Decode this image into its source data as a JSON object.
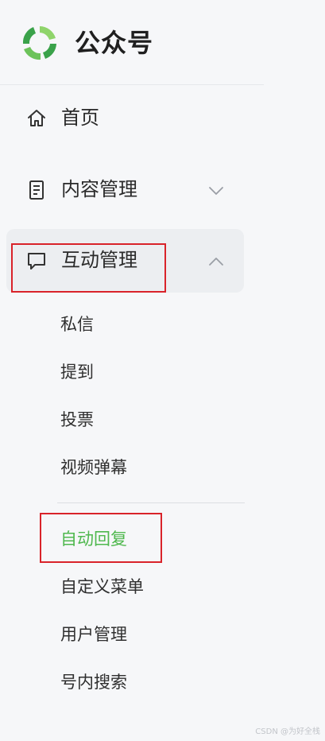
{
  "brand": {
    "title": "公众号",
    "logo_icon": "wechat-official-account-logo",
    "colors": {
      "logo_light": "#8fd46b",
      "logo_dark": "#3aa24a"
    }
  },
  "nav": {
    "home": {
      "label": "首页",
      "icon": "home-icon"
    },
    "content": {
      "label": "内容管理",
      "icon": "document-icon",
      "chevron": "chevron-down-icon"
    },
    "interaction": {
      "label": "互动管理",
      "icon": "message-icon",
      "chevron": "chevron-up-icon",
      "subitems": [
        {
          "label": "私信"
        },
        {
          "label": "提到"
        },
        {
          "label": "投票"
        },
        {
          "label": "视频弹幕"
        },
        {
          "label": "自动回复",
          "active": true
        },
        {
          "label": "自定义菜单"
        },
        {
          "label": "用户管理"
        },
        {
          "label": "号内搜索"
        }
      ]
    }
  },
  "colors": {
    "active_text": "#4fb84e",
    "highlight_box": "#d9232a",
    "expanded_bg": "#eceef1",
    "sidebar_bg": "#f6f7f9"
  },
  "watermark": "CSDN @为好全栈"
}
